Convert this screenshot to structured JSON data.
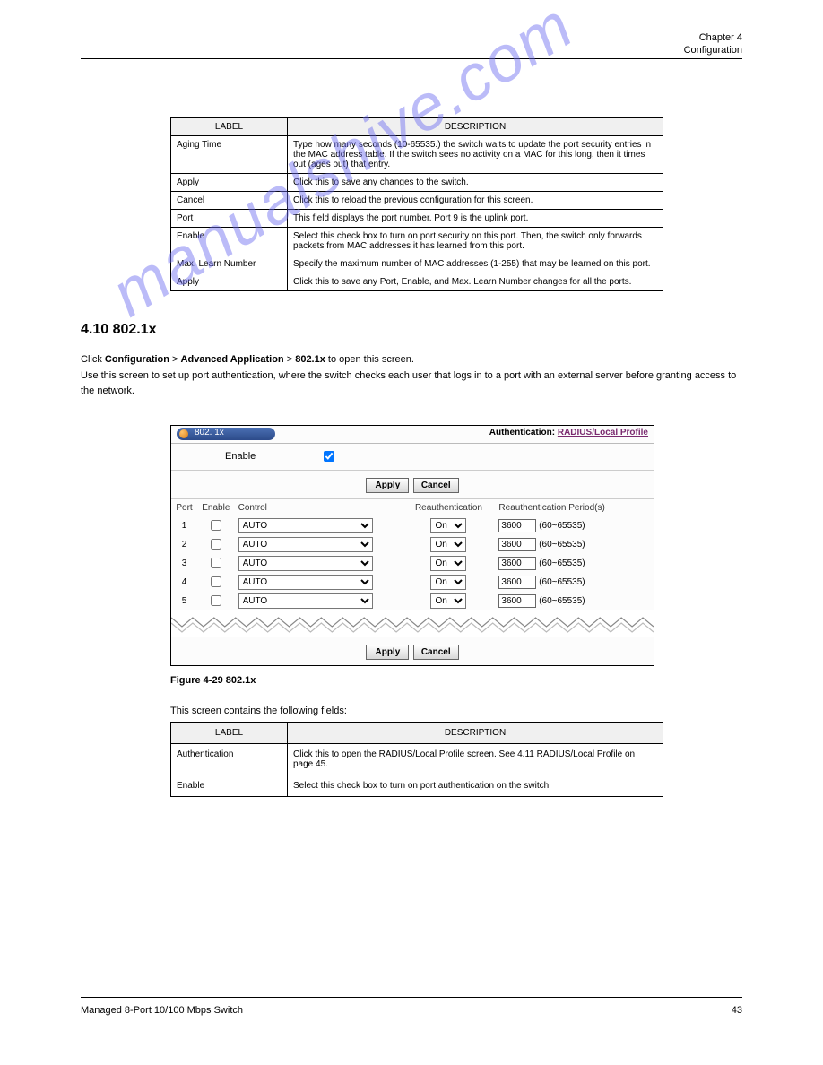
{
  "header": {
    "chapter": "Chapter 4",
    "title": "Configuration"
  },
  "watermark": "manualshive.com",
  "table1": {
    "head_label": "LABEL",
    "head_desc": "DESCRIPTION",
    "rows": [
      {
        "label": "Aging Time",
        "desc": "Type how many seconds (10-65535.) the switch waits to update the port security entries in the MAC address table. If the switch sees no activity on a MAC for this long, then it times out (ages out) that entry."
      },
      {
        "label": "Apply",
        "desc": "Click this to save any changes to the switch."
      },
      {
        "label": "Cancel",
        "desc": "Click this to reload the previous configuration for this screen."
      },
      {
        "label": "Port",
        "desc": "This field displays the port number. Port 9 is the uplink port."
      },
      {
        "label": "Enable",
        "desc": "Select this check box to turn on port security on this port. Then, the switch only forwards packets from MAC addresses it has learned from this port."
      },
      {
        "label": "Max. Learn Number",
        "desc": "Specify the maximum number of MAC addresses (1-255) that may be learned on this port."
      },
      {
        "label": "Apply",
        "desc": "Click this to save any Port, Enable, and Max. Learn Number changes for all the ports."
      }
    ]
  },
  "section": {
    "number": "4.10  802.1x",
    "para1_prefix": "Click ",
    "para1_bold1": "Configuration",
    "para1_mid": " > ",
    "para1_bold2": "Advanced Application",
    "para1_mid2": " > ",
    "para1_bold3": "802.1x",
    "para1_suffix": " to open this screen.",
    "para2": "Use this screen to set up port authentication, where the switch checks each user that logs in to a port with an external server before granting access to the network."
  },
  "screenshot": {
    "pill_label": "802. 1x",
    "auth_label": "Authentication: ",
    "auth_link": "RADIUS/Local Profile",
    "enable_label": "Enable",
    "enable_checked": true,
    "apply": "Apply",
    "cancel": "Cancel",
    "cols": {
      "port": "Port",
      "enable": "Enable",
      "control": "Control",
      "reauth": "Reauthentication",
      "period": "Reauthentication Period(s)"
    },
    "range_hint": "(60~65535)",
    "rows": [
      {
        "port": "1",
        "enable": false,
        "control": "AUTO",
        "reauth": "On",
        "period": "3600"
      },
      {
        "port": "2",
        "enable": false,
        "control": "AUTO",
        "reauth": "On",
        "period": "3600"
      },
      {
        "port": "3",
        "enable": false,
        "control": "AUTO",
        "reauth": "On",
        "period": "3600"
      },
      {
        "port": "4",
        "enable": false,
        "control": "AUTO",
        "reauth": "On",
        "period": "3600"
      },
      {
        "port": "5",
        "enable": false,
        "control": "AUTO",
        "reauth": "On",
        "period": "3600"
      }
    ]
  },
  "figure_caption": "Figure 4-29 802.1x",
  "table2": {
    "intro": "This screen contains the following fields:",
    "head_label": "LABEL",
    "head_desc": "DESCRIPTION",
    "rows": [
      {
        "label": "Authentication",
        "desc": "Click this to open the RADIUS/Local Profile screen. See 4.11 RADIUS/Local Profile on page 45."
      },
      {
        "label": "Enable",
        "desc": "Select this check box to turn on port authentication on the switch."
      }
    ]
  },
  "footer": {
    "left": "Managed 8-Port 10/100 Mbps Switch",
    "right": "43"
  }
}
